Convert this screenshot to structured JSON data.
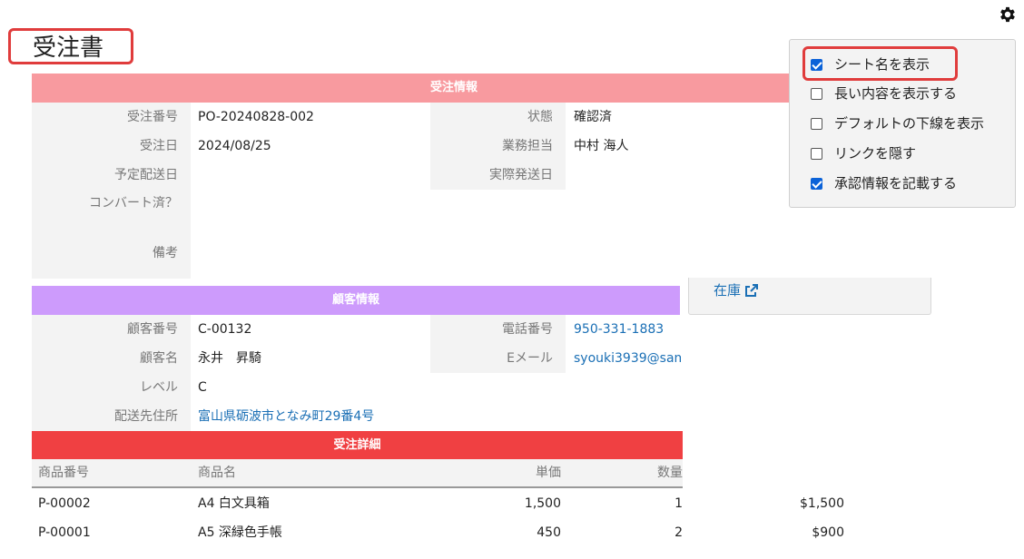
{
  "sheet_title": "受注書",
  "order_info": {
    "header": "受注情報",
    "order_no_label": "受注番号",
    "order_no": "PO-20240828-002",
    "order_date_label": "受注日",
    "order_date": "2024/08/25",
    "planned_ship_label": "予定配送日",
    "planned_ship": "",
    "converted_label": "コンバート済？",
    "converted": "",
    "notes_label": "備考",
    "notes": "",
    "status_label": "状態",
    "status": "確認済",
    "staff_label": "業務担当",
    "staff": "中村 海人",
    "actual_ship_label": "実際発送日",
    "actual_ship": ""
  },
  "customer_info": {
    "header": "顧客情報",
    "cust_no_label": "顧客番号",
    "cust_no": "C-00132",
    "cust_name_label": "顧客名",
    "cust_name": "永井　昇騎",
    "level_label": "レベル",
    "level": "C",
    "address_label": "配送先住所",
    "address": "富山県砺波市となみ町29番4号",
    "phone_label": "電話番号",
    "phone": "950-331-1883",
    "email_label": "Eメール",
    "email": "syouki3939@sam"
  },
  "order_details": {
    "header": "受注詳細",
    "columns": [
      "商品番号",
      "商品名",
      "単価",
      "数量"
    ],
    "rows": [
      {
        "product_no": "P-00002",
        "product_name": "A4 白文具箱",
        "unit_price": "1,500",
        "qty": "1",
        "amount": "$1,500"
      },
      {
        "product_no": "P-00001",
        "product_name": "A5 深緑色手帳",
        "unit_price": "450",
        "qty": "2",
        "amount": "$900"
      }
    ]
  },
  "stock_link": "在庫",
  "settings_panel": {
    "options": [
      {
        "label": "シート名を表示",
        "checked": true
      },
      {
        "label": "長い内容を表示する",
        "checked": false
      },
      {
        "label": "デフォルトの下線を表示",
        "checked": false
      },
      {
        "label": "リンクを隠す",
        "checked": false
      },
      {
        "label": "承認情報を記載する",
        "checked": true
      }
    ]
  },
  "colors": {
    "order_band": "#f89a9f",
    "customer_band": "#cd9bfc",
    "details_band": "#f04042",
    "link": "#1a6fb5",
    "checkbox_accent": "#0b62d8",
    "highlight": "#e03c3c"
  },
  "icons": {
    "settings": "gear-icon",
    "stock_external": "external-link-icon"
  }
}
